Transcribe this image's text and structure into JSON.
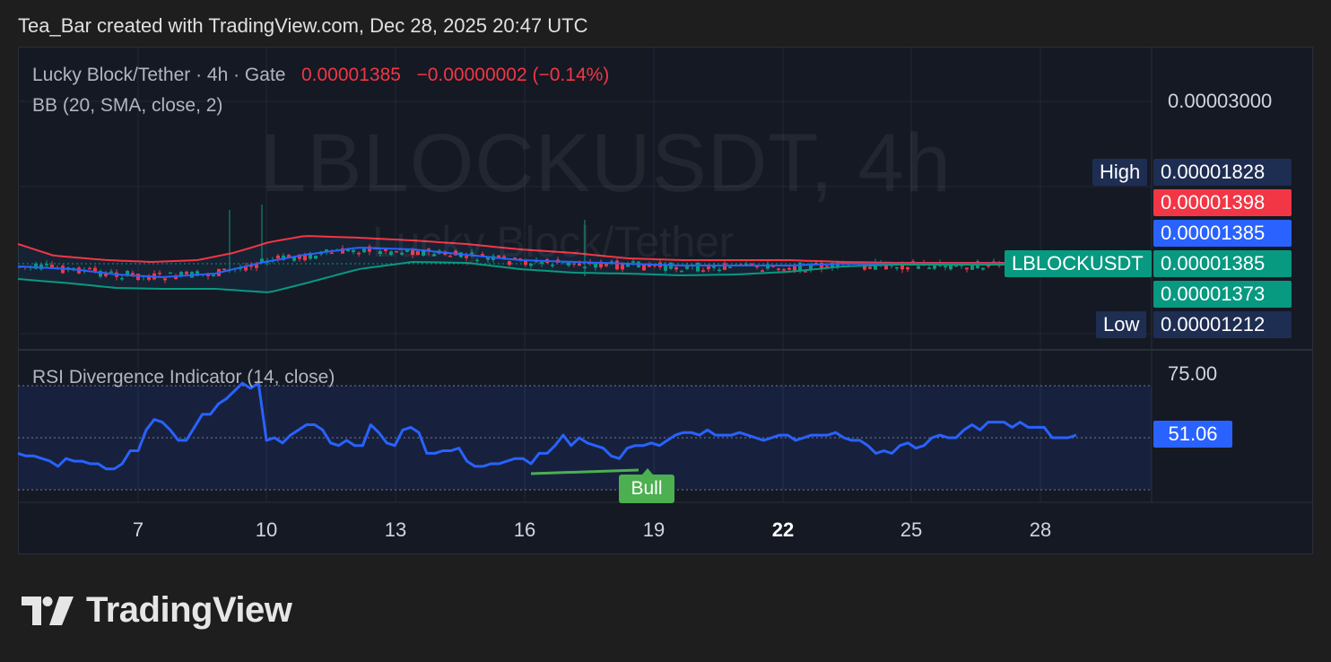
{
  "header": {
    "attribution": "Tea_Bar created with TradingView.com, Dec 28, 2025 20:47 UTC"
  },
  "legend": {
    "symbol": "Lucky Block/Tether · 4h · Gate",
    "price": "0.00001385",
    "change": "−0.00000002 (−0.14%)",
    "bb": "BB (20, SMA, close, 2)",
    "rsi": "RSI Divergence Indicator (14, close)"
  },
  "watermark": {
    "ticker": "LBLOCKUSDT, 4h",
    "name": "Lucky Block/Tether"
  },
  "price_scale": {
    "top_label": "0.00003000",
    "high": {
      "label": "High",
      "value": "0.00001828"
    },
    "bb_upper": "0.00001398",
    "bb_basis": "0.00001385",
    "last": {
      "label": "LBLOCKUSDT",
      "value": "0.00001385"
    },
    "bb_lower": "0.00001373",
    "low": {
      "label": "Low",
      "value": "0.00001212"
    }
  },
  "rsi_scale": {
    "top_label": "75.00",
    "current": "51.06"
  },
  "divergence": {
    "label": "Bull"
  },
  "x_ticks": [
    "7",
    "10",
    "13",
    "16",
    "19",
    "22",
    "25",
    "28"
  ],
  "colors": {
    "up": "#089981",
    "down": "#f23645",
    "bb_basis": "#2962ff",
    "bb_upper": "#f23645",
    "bb_lower": "#089981",
    "rsi": "#2962ff",
    "bull": "#4caf50",
    "high_tag": "#1e2d52",
    "last_tag": "#089981",
    "basis_tag": "#2962ff"
  },
  "chart_data": [
    {
      "type": "candlestick",
      "title": "Lucky Block/Tether · 4h · Gate",
      "x_ticks": [
        "7",
        "10",
        "13",
        "16",
        "19",
        "22",
        "25",
        "28"
      ],
      "series": [
        {
          "name": "BB (20, SMA, close, 2)",
          "values": {
            "upper": 1.398e-05,
            "basis": 1.385e-05,
            "lower": 1.373e-05
          }
        }
      ],
      "last_price": 1.385e-05,
      "high": 1.828e-05,
      "low": 1.212e-05,
      "ylim_top_tick": 3e-05
    },
    {
      "type": "line",
      "title": "RSI Divergence Indicator (14, close)",
      "y_ticks": [
        75.0
      ],
      "current": 51.06,
      "values": [
        44,
        43,
        43,
        42,
        41,
        39,
        42,
        41,
        41,
        40,
        40,
        38,
        38,
        40,
        45,
        45,
        53,
        57,
        56,
        53,
        49,
        49,
        54,
        59,
        59,
        63,
        65,
        68,
        71,
        69,
        71,
        49,
        50,
        48,
        51,
        53,
        55,
        55,
        53,
        48,
        47,
        49,
        47,
        47,
        55,
        52,
        48,
        47,
        53,
        54,
        52,
        44,
        44,
        45,
        45,
        46,
        41,
        39,
        39,
        40,
        40,
        41,
        42,
        42,
        40,
        44,
        44,
        47,
        51,
        47,
        50,
        48,
        47,
        46,
        43,
        42,
        46,
        47,
        47,
        48,
        47,
        49,
        51,
        52,
        52,
        51,
        53,
        51,
        51,
        51,
        52,
        51,
        50,
        49,
        50,
        51,
        51,
        49,
        50,
        51,
        51,
        51,
        52,
        50,
        49,
        49,
        47,
        44,
        45,
        44,
        47,
        48,
        46,
        47,
        50,
        51,
        50,
        50,
        53,
        55,
        53,
        56,
        56,
        56,
        54,
        56,
        54,
        54,
        54,
        50,
        50,
        50,
        51
      ]
    }
  ]
}
